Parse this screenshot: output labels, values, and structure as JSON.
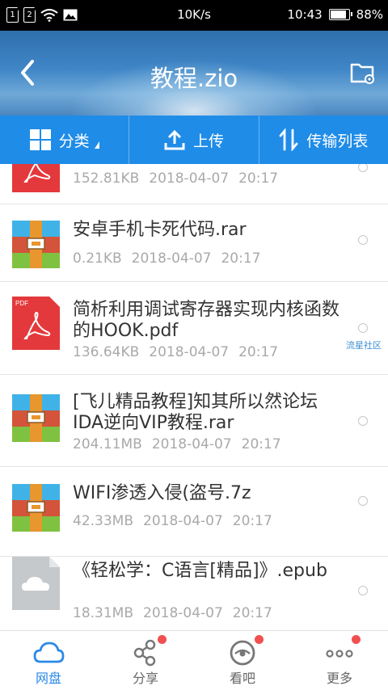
{
  "status_bar": {
    "sim1": "1",
    "sim2": "2",
    "speed": "10K/s",
    "time": "10:43",
    "battery": "88%",
    "battery_level": 0.88
  },
  "header": {
    "title": "教程.zio",
    "back_icon": "chevron-left-icon",
    "folder_icon": "folder-settings-icon"
  },
  "toolbar": {
    "category_label": "分类",
    "upload_label": "上传",
    "transfer_label": "传输列表"
  },
  "files": [
    {
      "name": "",
      "size": "152.81KB",
      "date": "2018-04-07",
      "time": "20:17",
      "type": "pdf"
    },
    {
      "name": "安卓手机卡死代码.rar",
      "size": "0.21KB",
      "date": "2018-04-07",
      "time": "20:17",
      "type": "rar"
    },
    {
      "name": "简析利用调试寄存器实现内核函数的HOOK.pdf",
      "size": "136.64KB",
      "date": "2018-04-07",
      "time": "20:17",
      "type": "pdf",
      "badge": "PDF"
    },
    {
      "name": "[飞儿精品教程]知其所以然论坛IDA逆向VIP教程.rar",
      "size": "204.11MB",
      "date": "2018-04-07",
      "time": "20:17",
      "type": "rar"
    },
    {
      "name": "WIFI渗透入侵(盗号.7z",
      "size": "42.33MB",
      "date": "2018-04-07",
      "time": "20:17",
      "type": "rar"
    },
    {
      "name": "《轻松学：C语言[精品]》.epub",
      "size": "18.31MB",
      "date": "2018-04-07",
      "time": "20:17",
      "type": "cloud"
    }
  ],
  "watermark": "流星社区",
  "bottom_nav": {
    "items": [
      {
        "label": "网盘",
        "icon": "cloud-icon",
        "active": true
      },
      {
        "label": "分享",
        "icon": "share-icon"
      },
      {
        "label": "看吧",
        "icon": "eye-icon"
      },
      {
        "label": "更多",
        "icon": "more-icon"
      }
    ]
  },
  "colors": {
    "accent": "#1f8ce8",
    "pdf_red": "#e4393c",
    "badge_red": "#f05050"
  }
}
